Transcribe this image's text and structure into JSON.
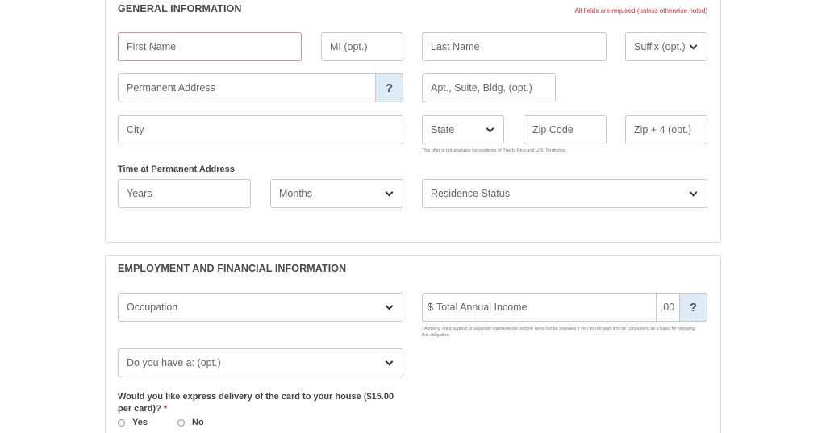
{
  "general": {
    "title": "GENERAL INFORMATION",
    "required_note": "All fields are required (unless otherwise noted)",
    "first_name": "First Name",
    "mi": "MI (opt.)",
    "last_name": "Last Name",
    "suffix": "Suffix (opt.)",
    "permanent_address": "Permanent Address",
    "help_glyph": "?",
    "apt": "Apt., Suite, Bldg. (opt.)",
    "city": "City",
    "state": "State",
    "zip": "Zip Code",
    "zip4": "Zip + 4 (opt.)",
    "territory_note": "This offer is not available for residents of Puerto Rico and U.S. Territories.",
    "time_label": "Time at Permanent Address",
    "years": "Years",
    "months": "Months",
    "residence_status": "Residence Status"
  },
  "employment": {
    "title": "EMPLOYMENT AND FINANCIAL INFORMATION",
    "occupation": "Occupation",
    "currency": "$",
    "income": "Total Annual Income",
    "cents": ".00",
    "help_glyph": "?",
    "alimony_note": "¹ Alimony, child support or separate maintenence income need not be revealed if you do not wish it to be considered as a basis for repaying this obligation.",
    "do_you_have": "Do you have a: (opt.)",
    "express_question": "Would you like express delivery of the card to your house ($15.00 per card)?",
    "required_star": "*",
    "yes": "Yes",
    "no": "No"
  },
  "colors": {
    "error_border": "#ef8a8a",
    "help_bg": "#ddebf6",
    "required_red": "#e0282a"
  },
  "icons": [
    "chevron-down-icon",
    "help-icon",
    "radio-icon"
  ]
}
